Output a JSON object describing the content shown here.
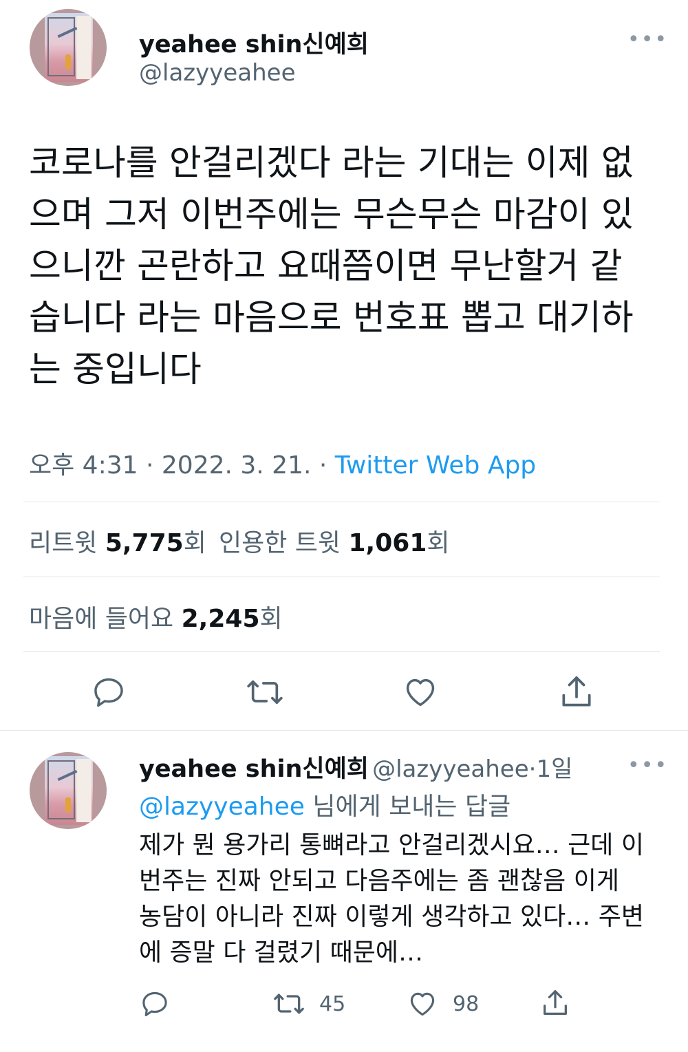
{
  "tweet": {
    "author_name": "yeahee shin신예희",
    "author_handle": "@lazyyeahee",
    "more_label": "•••",
    "text": "코로나를 안걸리겠다 라는 기대는 이제 없\n으며 그저 이번주에는 무슨무슨 마감이 있\n으니깐 곤란하고 요때쯤이면 무난할거 같\n습니다 라는 마음으로 번호표 뽑고 대기하\n는 중입니다",
    "time": "오후 4:31",
    "separator": "·",
    "date": "2022. 3. 21.",
    "source": "Twitter Web App",
    "retweets_label": "리트윗",
    "retweets_count": "5,775",
    "quotes_label": "인용한 트윗",
    "quotes_count": "1,061",
    "likes_label": "마음에 들어요",
    "likes_count": "2,245",
    "count_suffix": "회"
  },
  "reply": {
    "author_name": "yeahee shin신예희",
    "author_handle": "@lazyyeahee",
    "separator": "·",
    "time_ago": "1일",
    "more_label": "•••",
    "replying_to_handle": "@lazyyeahee",
    "replying_to_suffix": "님에게 보내는 답글",
    "text": "제가 뭔 용가리 통뼈라고 안걸리겠시요… 근데 이\n번주는 진짜 안되고 다음주에는 좀 괜찮음 이게\n농담이 아니라 진짜 이렇게 생각하고 있다… 주변\n에 증말 다 걸렸기 때문에…",
    "retweet_count": "45",
    "like_count": "98"
  },
  "icons": [
    "reply-icon",
    "retweet-icon",
    "like-icon",
    "share-icon",
    "more-icon"
  ],
  "colors": {
    "link": "#1d9bf0",
    "secondary": "#536471",
    "icon": "#536471"
  }
}
